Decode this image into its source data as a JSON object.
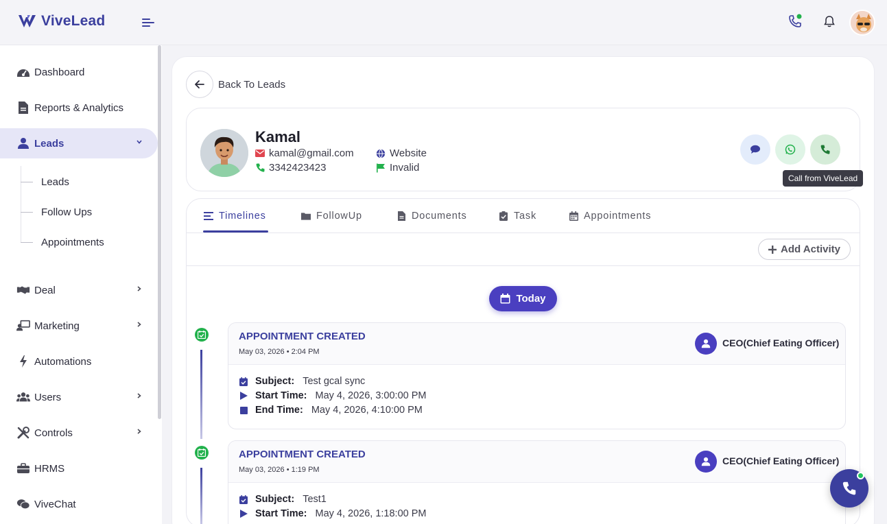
{
  "app": {
    "name": "ViveLead"
  },
  "sidebar": {
    "items": [
      {
        "label": "Dashboard",
        "icon": "dashboard-icon"
      },
      {
        "label": "Reports & Analytics",
        "icon": "report-icon"
      },
      {
        "label": "Leads",
        "icon": "user-icon"
      },
      {
        "label": "Deal",
        "icon": "handshake-icon"
      },
      {
        "label": "Marketing",
        "icon": "marketing-icon"
      },
      {
        "label": "Automations",
        "icon": "bolt-icon"
      },
      {
        "label": "Users",
        "icon": "users-icon"
      },
      {
        "label": "Controls",
        "icon": "tools-icon"
      },
      {
        "label": "HRMS",
        "icon": "briefcase-icon"
      },
      {
        "label": "ViveChat",
        "icon": "chat-icon"
      }
    ],
    "leads_sub": [
      {
        "label": "Leads"
      },
      {
        "label": "Follow Ups"
      },
      {
        "label": "Appointments"
      }
    ]
  },
  "back": {
    "label": "Back To Leads"
  },
  "lead": {
    "name": "Kamal",
    "email": "kamal@gmail.com",
    "phone": "3342423423",
    "source": "Website",
    "status": "Invalid"
  },
  "tooltip": {
    "text": "Call from ViveLead"
  },
  "tabs": [
    {
      "label": "Timelines",
      "active": true
    },
    {
      "label": "FollowUp"
    },
    {
      "label": "Documents"
    },
    {
      "label": "Task"
    },
    {
      "label": "Appointments"
    }
  ],
  "toolbar": {
    "add_activity": "Add Activity"
  },
  "timeline": {
    "today_label": "Today",
    "activities": [
      {
        "title": "APPOINTMENT CREATED",
        "date": "May 03, 2026 • 2:04 PM",
        "owner": "CEO(Chief Eating Officer)",
        "subject_label": "Subject:",
        "subject": "Test gcal sync",
        "start_label": "Start Time:",
        "start": "May 4, 2026, 3:00:00 PM",
        "end_label": "End Time:",
        "end": "May 4, 2026, 4:10:00 PM"
      },
      {
        "title": "APPOINTMENT CREATED",
        "date": "May 03, 2026 • 1:19 PM",
        "owner": "CEO(Chief Eating Officer)",
        "subject_label": "Subject:",
        "subject": "Test1",
        "start_label": "Start Time:",
        "start": "May 4, 2026, 1:18:00 PM"
      }
    ]
  },
  "colors": {
    "brand": "#3b3f9e",
    "accent": "#4a3fc0",
    "success": "#22b14c",
    "email": "#e0454f",
    "whatsapp": "#22c55e"
  }
}
